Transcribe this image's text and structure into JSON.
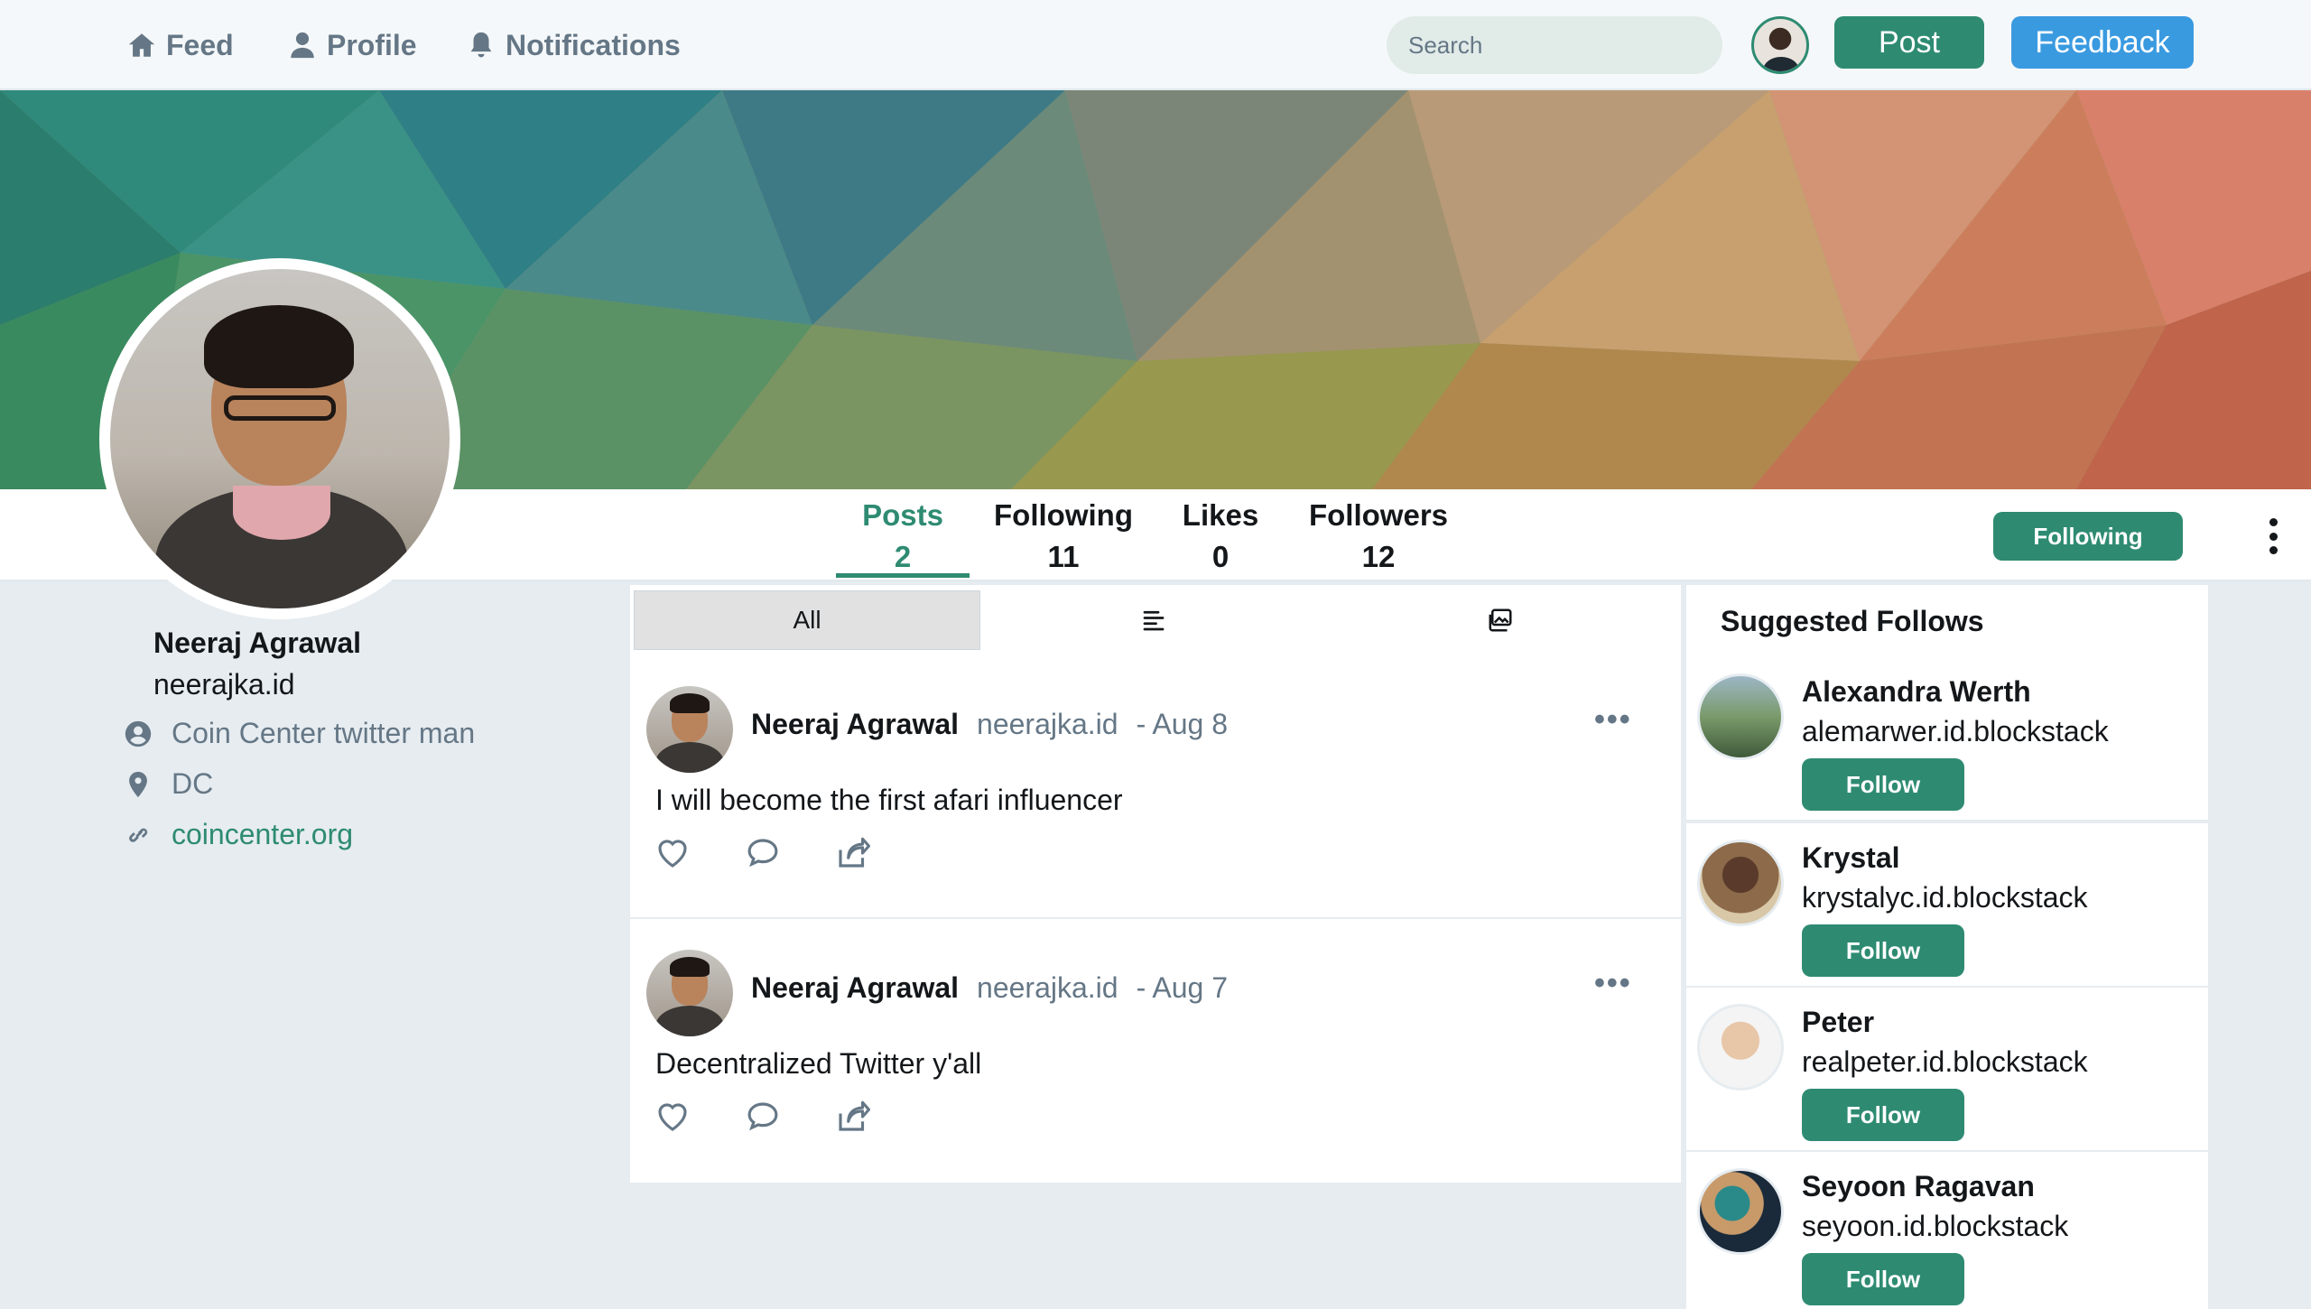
{
  "nav": {
    "feed_label": "Feed",
    "profile_label": "Profile",
    "notifications_label": "Notifications",
    "search_placeholder": "Search",
    "post_label": "Post",
    "feedback_label": "Feedback"
  },
  "colors": {
    "accent": "#2e8b72",
    "feedback": "#3a9ae0",
    "muted": "#657786",
    "background": "#e6ecf0"
  },
  "stats": [
    {
      "label": "Posts",
      "value": "2",
      "active": true
    },
    {
      "label": "Following",
      "value": "11"
    },
    {
      "label": "Likes",
      "value": "0"
    },
    {
      "label": "Followers",
      "value": "12"
    }
  ],
  "profile_bar": {
    "follow_state_label": "Following"
  },
  "profile": {
    "name": "Neeraj Agrawal",
    "handle": "neerajka.id",
    "bio": "Coin Center twitter man",
    "location": "DC",
    "website": "coincenter.org"
  },
  "feed_tabs": {
    "all_label": "All",
    "text_icon": "align-left-icon",
    "media_icon": "images-icon"
  },
  "posts": [
    {
      "author": "Neeraj Agrawal",
      "handle": "neerajka.id",
      "date": "- Aug 8",
      "text": "I will become the first afari influencer",
      "more": "•••"
    },
    {
      "author": "Neeraj Agrawal",
      "handle": "neerajka.id",
      "date": "- Aug 7",
      "text": "Decentralized Twitter y'all",
      "more": "•••"
    }
  ],
  "suggested": {
    "title": "Suggested Follows",
    "items": [
      {
        "name": "Alexandra Werth",
        "handle": "alemarwer.id.blockstack",
        "follow_label": "Follow"
      },
      {
        "name": "Krystal",
        "handle": "krystalyc.id.blockstack",
        "follow_label": "Follow"
      },
      {
        "name": "Peter",
        "handle": "realpeter.id.blockstack",
        "follow_label": "Follow"
      },
      {
        "name": "Seyoon Ragavan",
        "handle": "seyoon.id.blockstack",
        "follow_label": "Follow"
      }
    ]
  }
}
